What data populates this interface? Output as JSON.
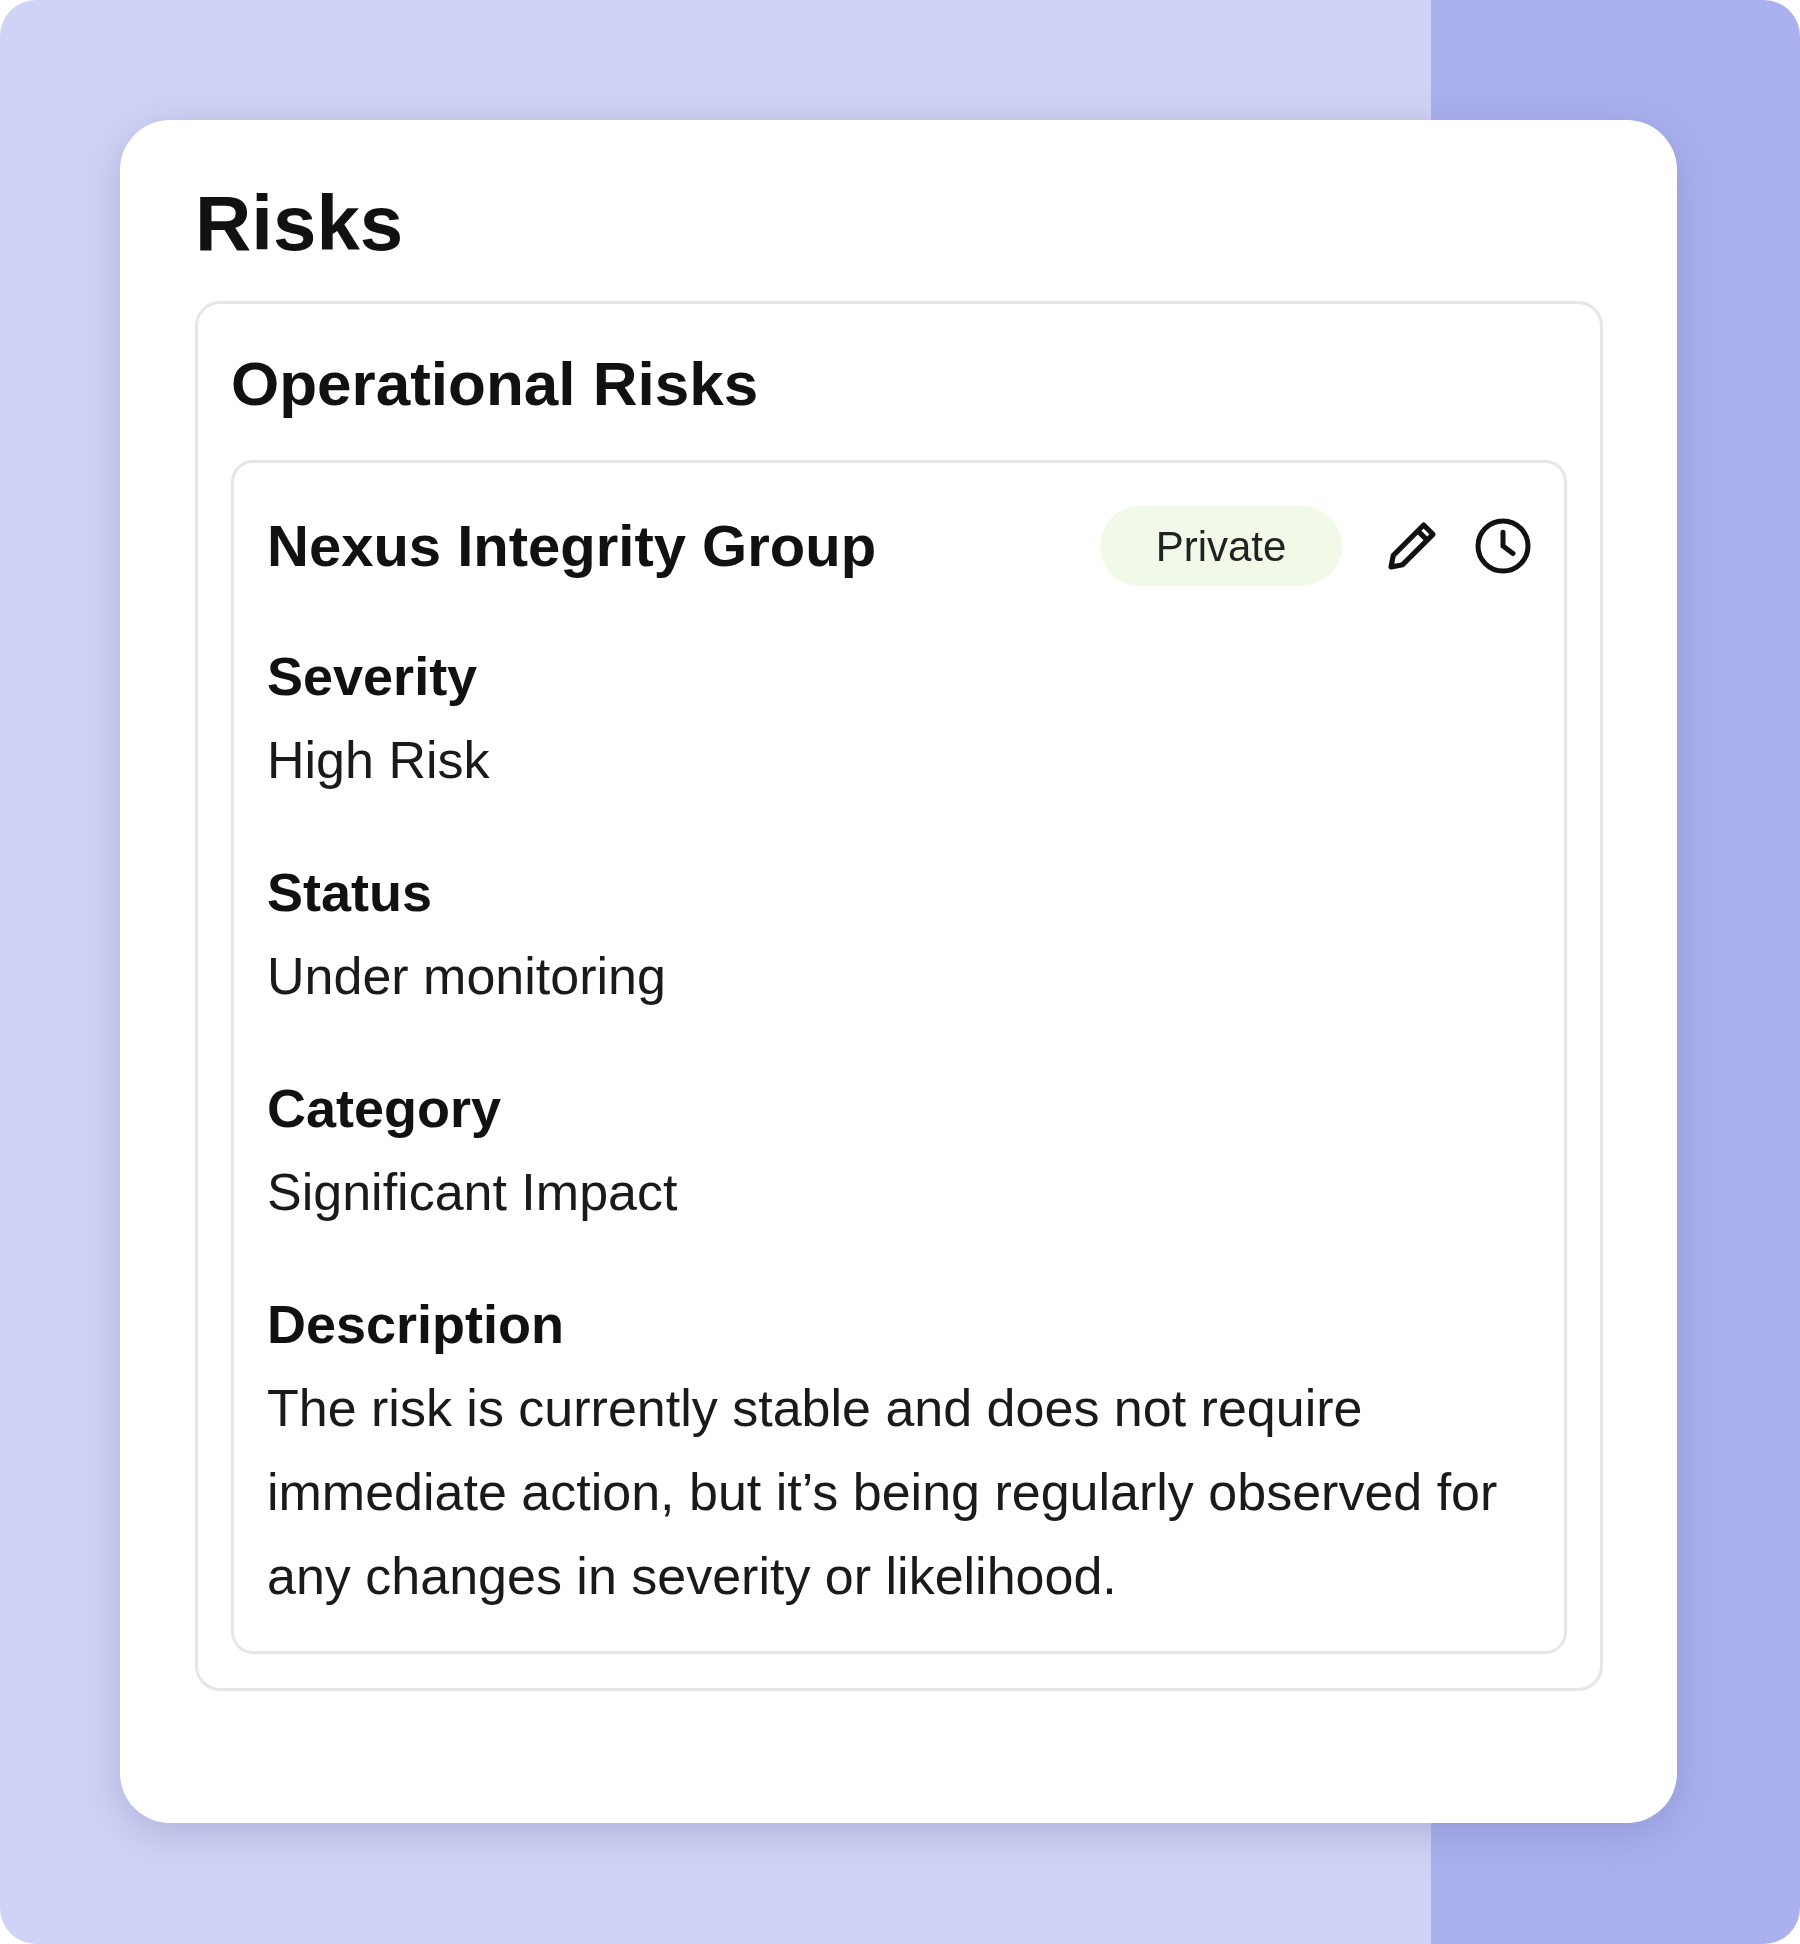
{
  "title": "Risks",
  "section": {
    "title": "Operational Risks",
    "risk": {
      "name": "Nexus Integrity Group",
      "visibility": "Private",
      "fields": [
        {
          "label": "Severity",
          "value": "High Risk"
        },
        {
          "label": "Status",
          "value": "Under monitoring"
        },
        {
          "label": "Category",
          "value": "Significant Impact"
        },
        {
          "label": "Description",
          "value": "The risk is currently stable and does not require immediate action, but it’s being regularly observed for any changes in severity or likelihood."
        }
      ]
    }
  }
}
